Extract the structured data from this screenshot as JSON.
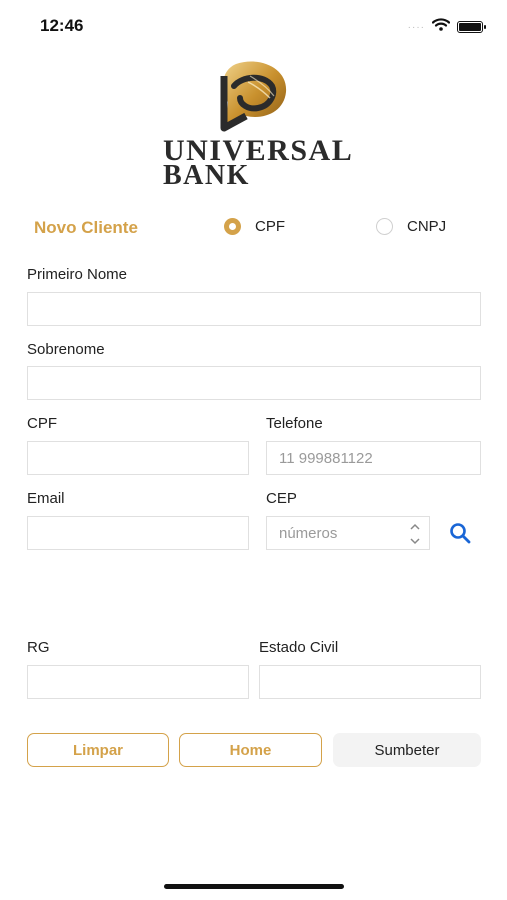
{
  "status_bar": {
    "time": "12:46",
    "signal_dots": "····"
  },
  "brand": {
    "line1": "UNIVERSAL",
    "line2": "BANK",
    "gold": "#d4a24a",
    "dark": "#2b2b2b"
  },
  "header": {
    "title": "Novo Cliente",
    "options": [
      {
        "label": "CPF",
        "selected": true
      },
      {
        "label": "CNPJ",
        "selected": false
      }
    ]
  },
  "form": {
    "primeiro_nome": {
      "label": "Primeiro Nome",
      "value": "",
      "placeholder": ""
    },
    "sobrenome": {
      "label": "Sobrenome",
      "value": "",
      "placeholder": ""
    },
    "cpf": {
      "label": "CPF",
      "value": "",
      "placeholder": ""
    },
    "telefone": {
      "label": "Telefone",
      "value": "",
      "placeholder": "11 999881122"
    },
    "email": {
      "label": "Email",
      "value": "",
      "placeholder": ""
    },
    "cep": {
      "label": "CEP",
      "value": "",
      "placeholder": "números"
    },
    "rg": {
      "label": "RG",
      "value": "",
      "placeholder": ""
    },
    "estado_civil": {
      "label": "Estado Civil",
      "value": "",
      "placeholder": ""
    }
  },
  "buttons": {
    "limpar": "Limpar",
    "home": "Home",
    "submeter": "Sumbeter"
  },
  "icons": {
    "search": "search-icon",
    "wifi": "wifi-icon",
    "battery": "battery-icon"
  }
}
